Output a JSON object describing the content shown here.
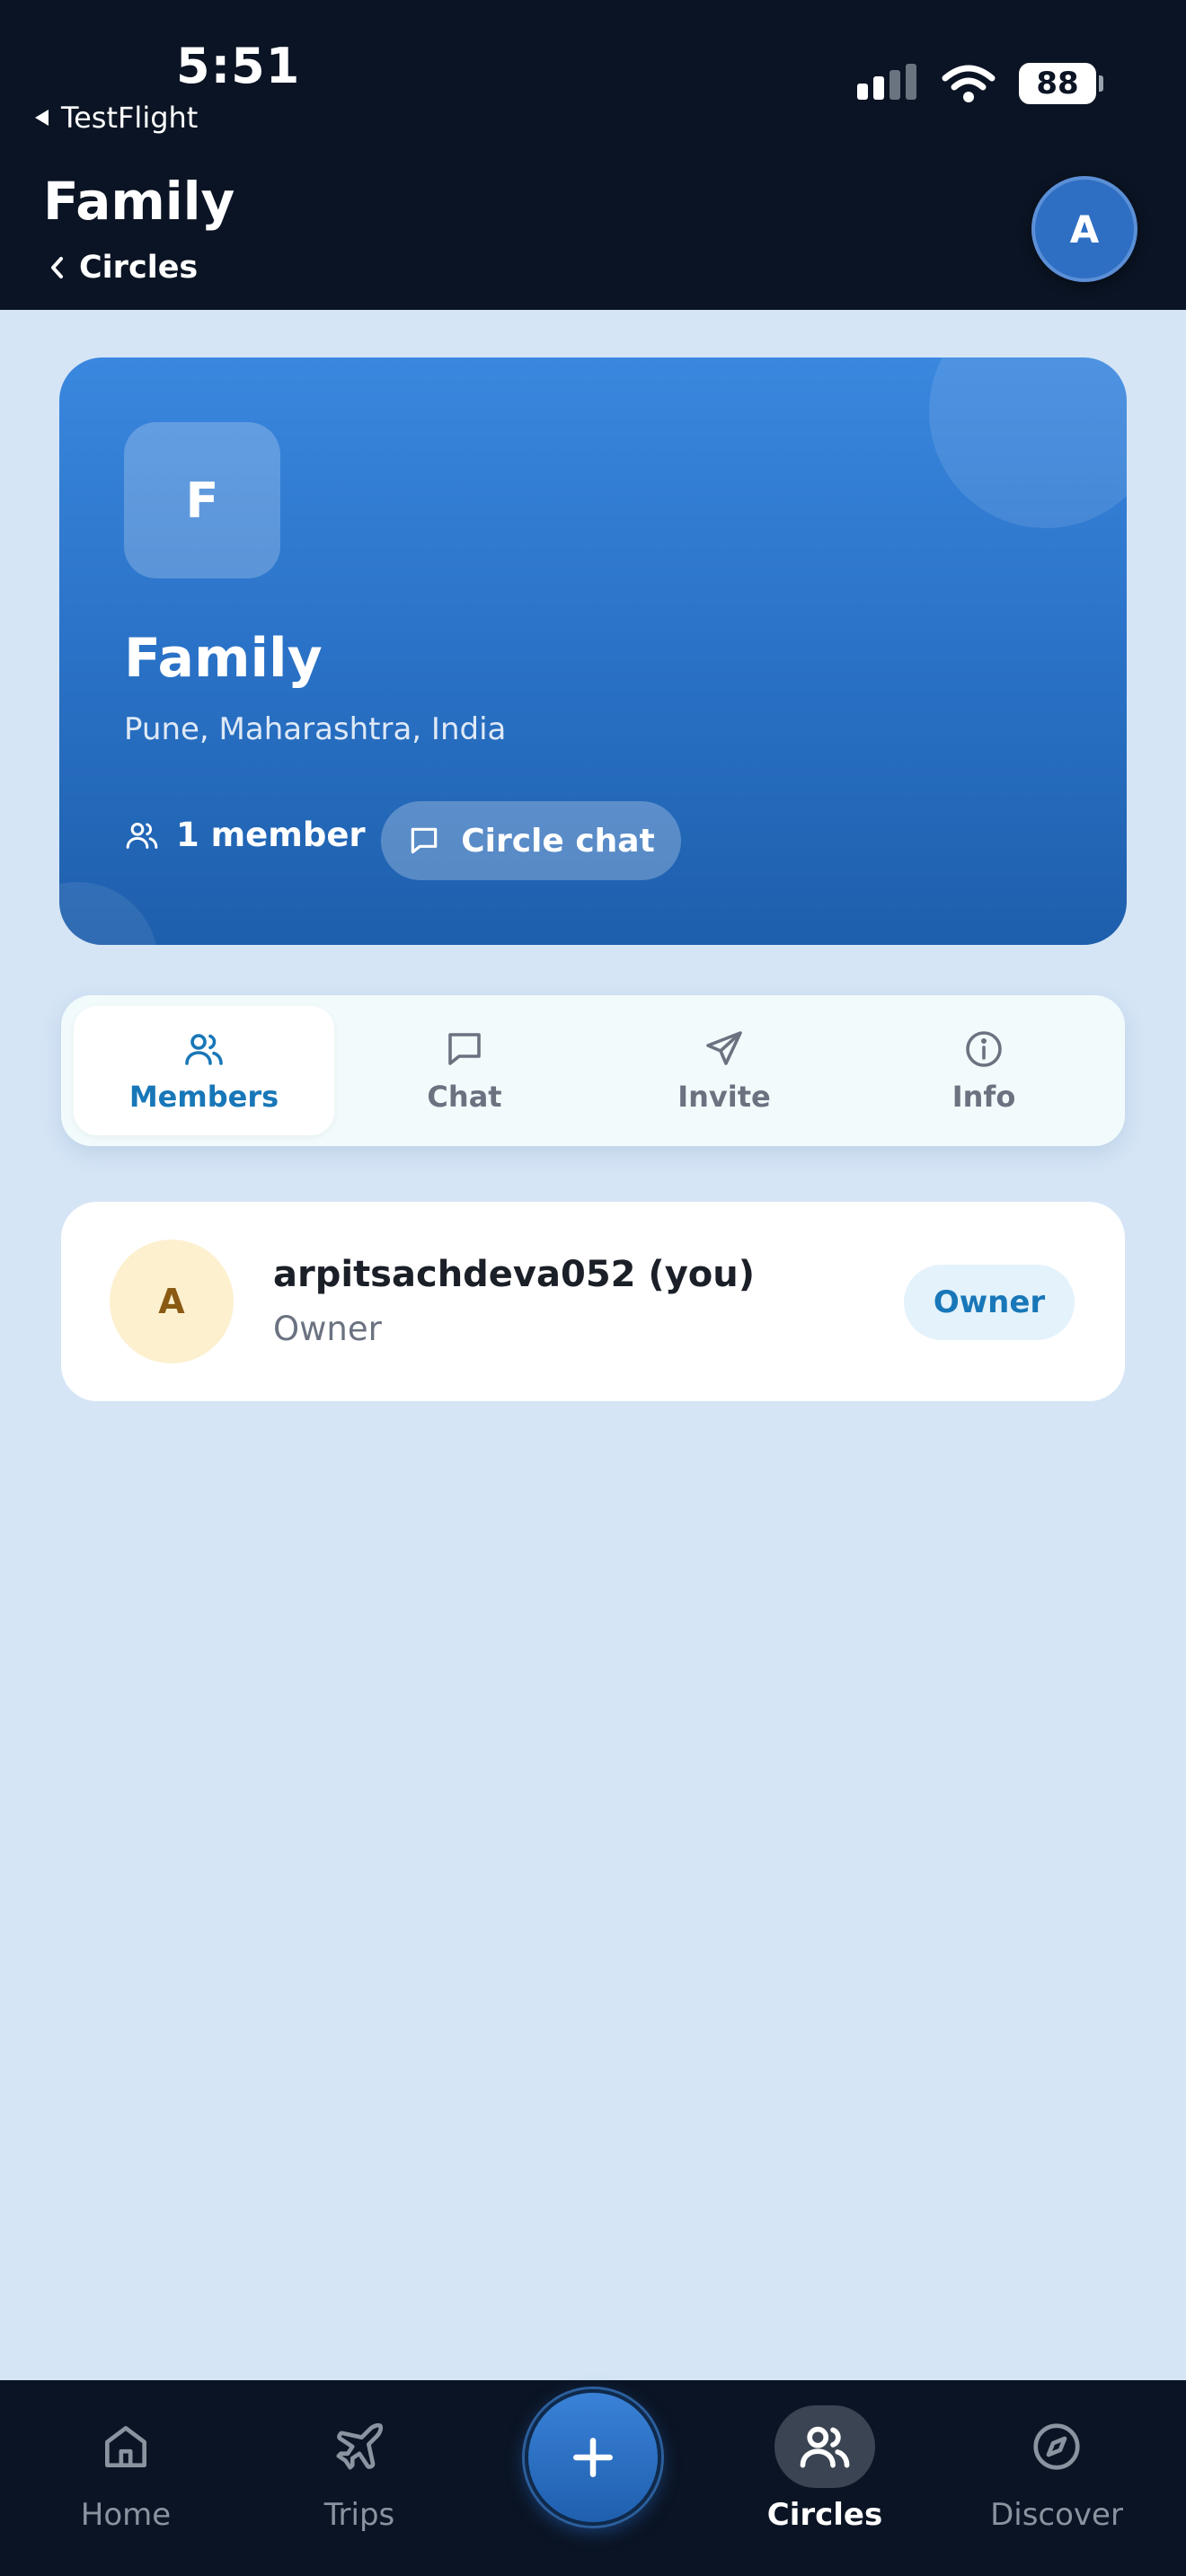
{
  "status_bar": {
    "time": "5:51",
    "back_app": "TestFlight",
    "battery": "88"
  },
  "header": {
    "title": "Family",
    "breadcrumb": "Circles",
    "avatar_initial": "A"
  },
  "circle": {
    "initial": "F",
    "name": "Family",
    "location": "Pune, Maharashtra, India",
    "member_count": "1 member",
    "chat_button": "Circle chat"
  },
  "tabs": [
    {
      "label": "Members",
      "icon": "users-icon",
      "active": true
    },
    {
      "label": "Chat",
      "icon": "chat-icon",
      "active": false
    },
    {
      "label": "Invite",
      "icon": "send-icon",
      "active": false
    },
    {
      "label": "Info",
      "icon": "info-icon",
      "active": false
    }
  ],
  "members": [
    {
      "initial": "A",
      "name": "arpitsachdeva052 (you)",
      "role": "Owner",
      "badge": "Owner"
    }
  ],
  "bottom_nav": [
    {
      "label": "Home",
      "icon": "home-icon",
      "active": false
    },
    {
      "label": "Trips",
      "icon": "plane-icon",
      "active": false
    },
    {
      "label": "Circles",
      "icon": "users-icon",
      "active": true
    },
    {
      "label": "Discover",
      "icon": "compass-icon",
      "active": false
    }
  ],
  "colors": {
    "accent": "#1877b8",
    "header_bg": "#0b1424",
    "page_bg": "#d5e5f6"
  }
}
